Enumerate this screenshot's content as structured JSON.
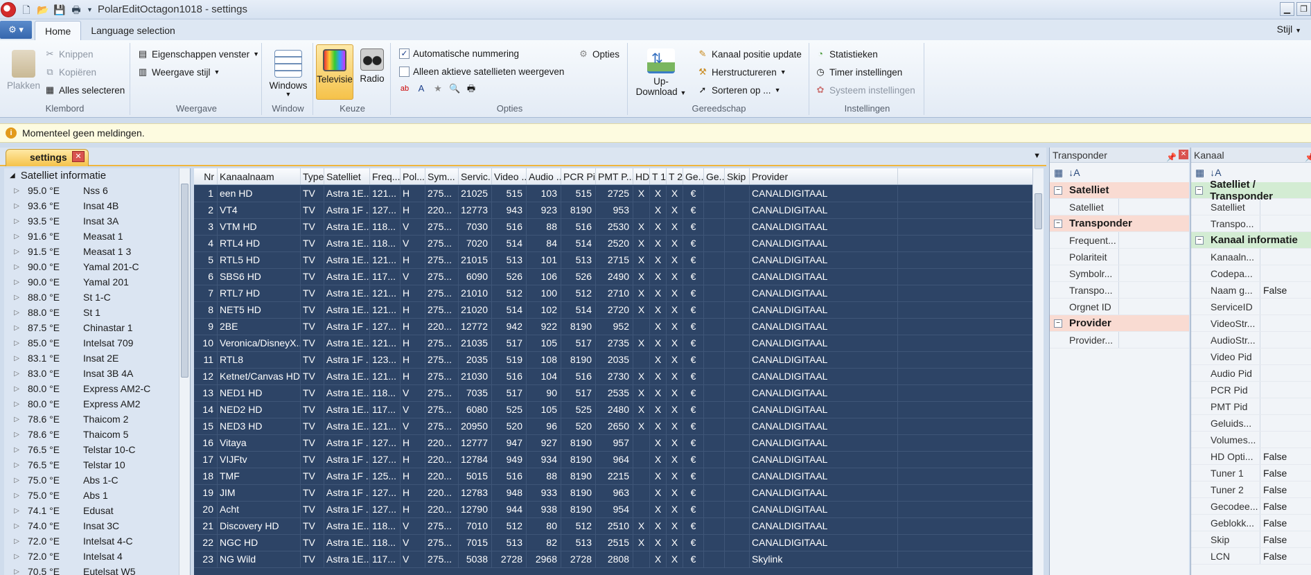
{
  "window": {
    "title": "PolarEditOctagon1018 - settings"
  },
  "tabs": {
    "home": "Home",
    "language": "Language selection",
    "stijl": "Stijl"
  },
  "ribbon": {
    "klembord": {
      "label": "Klembord",
      "plakken": "Plakken",
      "knippen": "Knippen",
      "kopieren": "Kopiëren",
      "alles": "Alles selecteren"
    },
    "weergave": {
      "label": "Weergave",
      "eigenschappen": "Eigenschappen venster",
      "stijl": "Weergave stijl"
    },
    "window": {
      "label": "Window",
      "windows": "Windows"
    },
    "keuze": {
      "label": "Keuze",
      "televisie": "Televisie",
      "radio": "Radio"
    },
    "opties": {
      "label": "Opties",
      "auto": "Automatische nummering",
      "alleen": "Alleen aktieve satellieten weergeven",
      "opties": "Opties"
    },
    "updown": {
      "line1": "Up-",
      "line2": "Download"
    },
    "gereedschap": {
      "label": "Gereedschap",
      "kanaal": "Kanaal positie update",
      "herstructureren": "Herstructureren",
      "sorteren": "Sorteren op ..."
    },
    "instellingen": {
      "label": "Instellingen",
      "statistieken": "Statistieken",
      "timer": "Timer instellingen",
      "systeem": "Systeem instellingen"
    }
  },
  "notification": "Momenteel geen meldingen.",
  "doc_tab": "settings",
  "tree": {
    "header": "Satelliet informatie",
    "items": [
      {
        "pos": "95.0 °E",
        "name": "Nss 6"
      },
      {
        "pos": "93.6 °E",
        "name": "Insat 4B"
      },
      {
        "pos": "93.5 °E",
        "name": "Insat 3A"
      },
      {
        "pos": "91.6 °E",
        "name": "Measat 1"
      },
      {
        "pos": "91.5 °E",
        "name": "Measat 1 3"
      },
      {
        "pos": "90.0 °E",
        "name": "Yamal 201-C"
      },
      {
        "pos": "90.0 °E",
        "name": "Yamal 201"
      },
      {
        "pos": "88.0 °E",
        "name": "St 1-C"
      },
      {
        "pos": "88.0 °E",
        "name": "St 1"
      },
      {
        "pos": "87.5 °E",
        "name": "Chinastar 1"
      },
      {
        "pos": "85.0 °E",
        "name": "Intelsat 709"
      },
      {
        "pos": "83.1 °E",
        "name": "Insat 2E"
      },
      {
        "pos": "83.0 °E",
        "name": "Insat 3B 4A"
      },
      {
        "pos": "80.0 °E",
        "name": "Express AM2-C"
      },
      {
        "pos": "80.0 °E",
        "name": "Express AM2"
      },
      {
        "pos": "78.6 °E",
        "name": "Thaicom 2"
      },
      {
        "pos": "78.6 °E",
        "name": "Thaicom 5"
      },
      {
        "pos": "76.5 °E",
        "name": "Telstar 10-C"
      },
      {
        "pos": "76.5 °E",
        "name": "Telstar 10"
      },
      {
        "pos": "75.0 °E",
        "name": "Abs 1-C"
      },
      {
        "pos": "75.0 °E",
        "name": "Abs 1"
      },
      {
        "pos": "74.1 °E",
        "name": "Edusat"
      },
      {
        "pos": "74.0 °E",
        "name": "Insat 3C"
      },
      {
        "pos": "72.0 °E",
        "name": "Intelsat 4-C"
      },
      {
        "pos": "72.0 °E",
        "name": "Intelsat 4"
      },
      {
        "pos": "70.5 °E",
        "name": "Eutelsat W5"
      }
    ]
  },
  "grid": {
    "columns": [
      "Nr",
      "Kanaalnaam",
      "Type",
      "Satelliet",
      "Freq...",
      "Pol...",
      "Sym...",
      "Servic...",
      "Video ...",
      "Audio ...",
      "PCR Pid",
      "PMT P...",
      "HD",
      "T 1",
      "T 2",
      "Ge...",
      "Ge...",
      "Skip",
      "Provider"
    ],
    "rows": [
      [
        "1",
        "een HD",
        "TV",
        "Astra 1E...",
        "121...",
        "H",
        "275...",
        "21025",
        "515",
        "103",
        "515",
        "2725",
        "X",
        "X",
        "X",
        "€",
        "",
        "",
        "CANALDIGITAAL"
      ],
      [
        "2",
        "VT4",
        "TV",
        "Astra 1F ...",
        "127...",
        "H",
        "220...",
        "12773",
        "943",
        "923",
        "8190",
        "953",
        "",
        "X",
        "X",
        "€",
        "",
        "",
        "CANALDIGITAAL"
      ],
      [
        "3",
        "VTM HD",
        "TV",
        "Astra 1E...",
        "118...",
        "V",
        "275...",
        "7030",
        "516",
        "88",
        "516",
        "2530",
        "X",
        "X",
        "X",
        "€",
        "",
        "",
        "CANALDIGITAAL"
      ],
      [
        "4",
        "RTL4 HD",
        "TV",
        "Astra 1E...",
        "118...",
        "V",
        "275...",
        "7020",
        "514",
        "84",
        "514",
        "2520",
        "X",
        "X",
        "X",
        "€",
        "",
        "",
        "CANALDIGITAAL"
      ],
      [
        "5",
        "RTL5 HD",
        "TV",
        "Astra 1E...",
        "121...",
        "H",
        "275...",
        "21015",
        "513",
        "101",
        "513",
        "2715",
        "X",
        "X",
        "X",
        "€",
        "",
        "",
        "CANALDIGITAAL"
      ],
      [
        "6",
        "SBS6 HD",
        "TV",
        "Astra 1E...",
        "117...",
        "V",
        "275...",
        "6090",
        "526",
        "106",
        "526",
        "2490",
        "X",
        "X",
        "X",
        "€",
        "",
        "",
        "CANALDIGITAAL"
      ],
      [
        "7",
        "RTL7 HD",
        "TV",
        "Astra 1E...",
        "121...",
        "H",
        "275...",
        "21010",
        "512",
        "100",
        "512",
        "2710",
        "X",
        "X",
        "X",
        "€",
        "",
        "",
        "CANALDIGITAAL"
      ],
      [
        "8",
        "NET5 HD",
        "TV",
        "Astra 1E...",
        "121...",
        "H",
        "275...",
        "21020",
        "514",
        "102",
        "514",
        "2720",
        "X",
        "X",
        "X",
        "€",
        "",
        "",
        "CANALDIGITAAL"
      ],
      [
        "9",
        "2BE",
        "TV",
        "Astra 1F ...",
        "127...",
        "H",
        "220...",
        "12772",
        "942",
        "922",
        "8190",
        "952",
        "",
        "X",
        "X",
        "€",
        "",
        "",
        "CANALDIGITAAL"
      ],
      [
        "10",
        "Veronica/DisneyX...",
        "TV",
        "Astra 1E...",
        "121...",
        "H",
        "275...",
        "21035",
        "517",
        "105",
        "517",
        "2735",
        "X",
        "X",
        "X",
        "€",
        "",
        "",
        "CANALDIGITAAL"
      ],
      [
        "11",
        "RTL8",
        "TV",
        "Astra 1F ...",
        "123...",
        "H",
        "275...",
        "2035",
        "519",
        "108",
        "8190",
        "2035",
        "",
        "X",
        "X",
        "€",
        "",
        "",
        "CANALDIGITAAL"
      ],
      [
        "12",
        "Ketnet/Canvas HD",
        "TV",
        "Astra 1E...",
        "121...",
        "H",
        "275...",
        "21030",
        "516",
        "104",
        "516",
        "2730",
        "X",
        "X",
        "X",
        "€",
        "",
        "",
        "CANALDIGITAAL"
      ],
      [
        "13",
        "NED1 HD",
        "TV",
        "Astra 1E...",
        "118...",
        "V",
        "275...",
        "7035",
        "517",
        "90",
        "517",
        "2535",
        "X",
        "X",
        "X",
        "€",
        "",
        "",
        "CANALDIGITAAL"
      ],
      [
        "14",
        "NED2 HD",
        "TV",
        "Astra 1E...",
        "117...",
        "V",
        "275...",
        "6080",
        "525",
        "105",
        "525",
        "2480",
        "X",
        "X",
        "X",
        "€",
        "",
        "",
        "CANALDIGITAAL"
      ],
      [
        "15",
        "NED3 HD",
        "TV",
        "Astra 1E...",
        "121...",
        "V",
        "275...",
        "20950",
        "520",
        "96",
        "520",
        "2650",
        "X",
        "X",
        "X",
        "€",
        "",
        "",
        "CANALDIGITAAL"
      ],
      [
        "16",
        "Vitaya",
        "TV",
        "Astra 1F ...",
        "127...",
        "H",
        "220...",
        "12777",
        "947",
        "927",
        "8190",
        "957",
        "",
        "X",
        "X",
        "€",
        "",
        "",
        "CANALDIGITAAL"
      ],
      [
        "17",
        "VIJFtv",
        "TV",
        "Astra 1F ...",
        "127...",
        "H",
        "220...",
        "12784",
        "949",
        "934",
        "8190",
        "964",
        "",
        "X",
        "X",
        "€",
        "",
        "",
        "CANALDIGITAAL"
      ],
      [
        "18",
        "TMF",
        "TV",
        "Astra 1F ...",
        "125...",
        "H",
        "220...",
        "5015",
        "516",
        "88",
        "8190",
        "2215",
        "",
        "X",
        "X",
        "€",
        "",
        "",
        "CANALDIGITAAL"
      ],
      [
        "19",
        "JIM",
        "TV",
        "Astra 1F ...",
        "127...",
        "H",
        "220...",
        "12783",
        "948",
        "933",
        "8190",
        "963",
        "",
        "X",
        "X",
        "€",
        "",
        "",
        "CANALDIGITAAL"
      ],
      [
        "20",
        "Acht",
        "TV",
        "Astra 1F ...",
        "127...",
        "H",
        "220...",
        "12790",
        "944",
        "938",
        "8190",
        "954",
        "",
        "X",
        "X",
        "€",
        "",
        "",
        "CANALDIGITAAL"
      ],
      [
        "21",
        "Discovery HD",
        "TV",
        "Astra 1E...",
        "118...",
        "V",
        "275...",
        "7010",
        "512",
        "80",
        "512",
        "2510",
        "X",
        "X",
        "X",
        "€",
        "",
        "",
        "CANALDIGITAAL"
      ],
      [
        "22",
        "NGC HD",
        "TV",
        "Astra 1E...",
        "118...",
        "V",
        "275...",
        "7015",
        "513",
        "82",
        "513",
        "2515",
        "X",
        "X",
        "X",
        "€",
        "",
        "",
        "CANALDIGITAAL"
      ],
      [
        "23",
        "NG Wild",
        "TV",
        "Astra 1E...",
        "117...",
        "V",
        "275...",
        "5038",
        "2728",
        "2968",
        "2728",
        "2808",
        "",
        "X",
        "X",
        "€",
        "",
        "",
        "Skylink"
      ]
    ]
  },
  "transponder_panel": {
    "title": "Transponder",
    "sections": [
      {
        "name": "Satelliet",
        "rows": [
          {
            "k": "Satelliet",
            "v": ""
          }
        ]
      },
      {
        "name": "Transponder",
        "rows": [
          {
            "k": "Frequent...",
            "v": ""
          },
          {
            "k": "Polariteit",
            "v": ""
          },
          {
            "k": "Symbolr...",
            "v": ""
          },
          {
            "k": "Transpo...",
            "v": ""
          },
          {
            "k": "Orgnet ID",
            "v": ""
          }
        ]
      },
      {
        "name": "Provider",
        "rows": [
          {
            "k": "Provider...",
            "v": ""
          }
        ]
      }
    ]
  },
  "kanaal_panel": {
    "title": "Kanaal",
    "sections": [
      {
        "name": "Satelliet / Transponder",
        "rows": [
          {
            "k": "Satelliet",
            "v": ""
          },
          {
            "k": "Transpo...",
            "v": ""
          }
        ]
      },
      {
        "name": "Kanaal informatie",
        "rows": [
          {
            "k": "Kanaaln...",
            "v": ""
          },
          {
            "k": "Codepa...",
            "v": ""
          },
          {
            "k": "Naam g...",
            "v": "False"
          },
          {
            "k": "ServiceID",
            "v": ""
          },
          {
            "k": "VideoStr...",
            "v": ""
          },
          {
            "k": "AudioStr...",
            "v": ""
          },
          {
            "k": "Video Pid",
            "v": ""
          },
          {
            "k": "Audio Pid",
            "v": ""
          },
          {
            "k": "PCR Pid",
            "v": ""
          },
          {
            "k": "PMT Pid",
            "v": ""
          },
          {
            "k": "Geluids...",
            "v": ""
          },
          {
            "k": "Volumes...",
            "v": ""
          },
          {
            "k": "HD Opti...",
            "v": "False"
          },
          {
            "k": "Tuner 1",
            "v": "False"
          },
          {
            "k": "Tuner 2",
            "v": "False"
          },
          {
            "k": "Gecodee...",
            "v": "False"
          },
          {
            "k": "Geblokk...",
            "v": "False"
          },
          {
            "k": "Skip",
            "v": "False"
          },
          {
            "k": "LCN",
            "v": "False"
          }
        ]
      }
    ]
  },
  "colors": {
    "grid_bg": "#2d4466",
    "sat_section": "#f9dbd2",
    "kanaal_section": "#d3ecd3",
    "highlight": "#f5c24a"
  }
}
